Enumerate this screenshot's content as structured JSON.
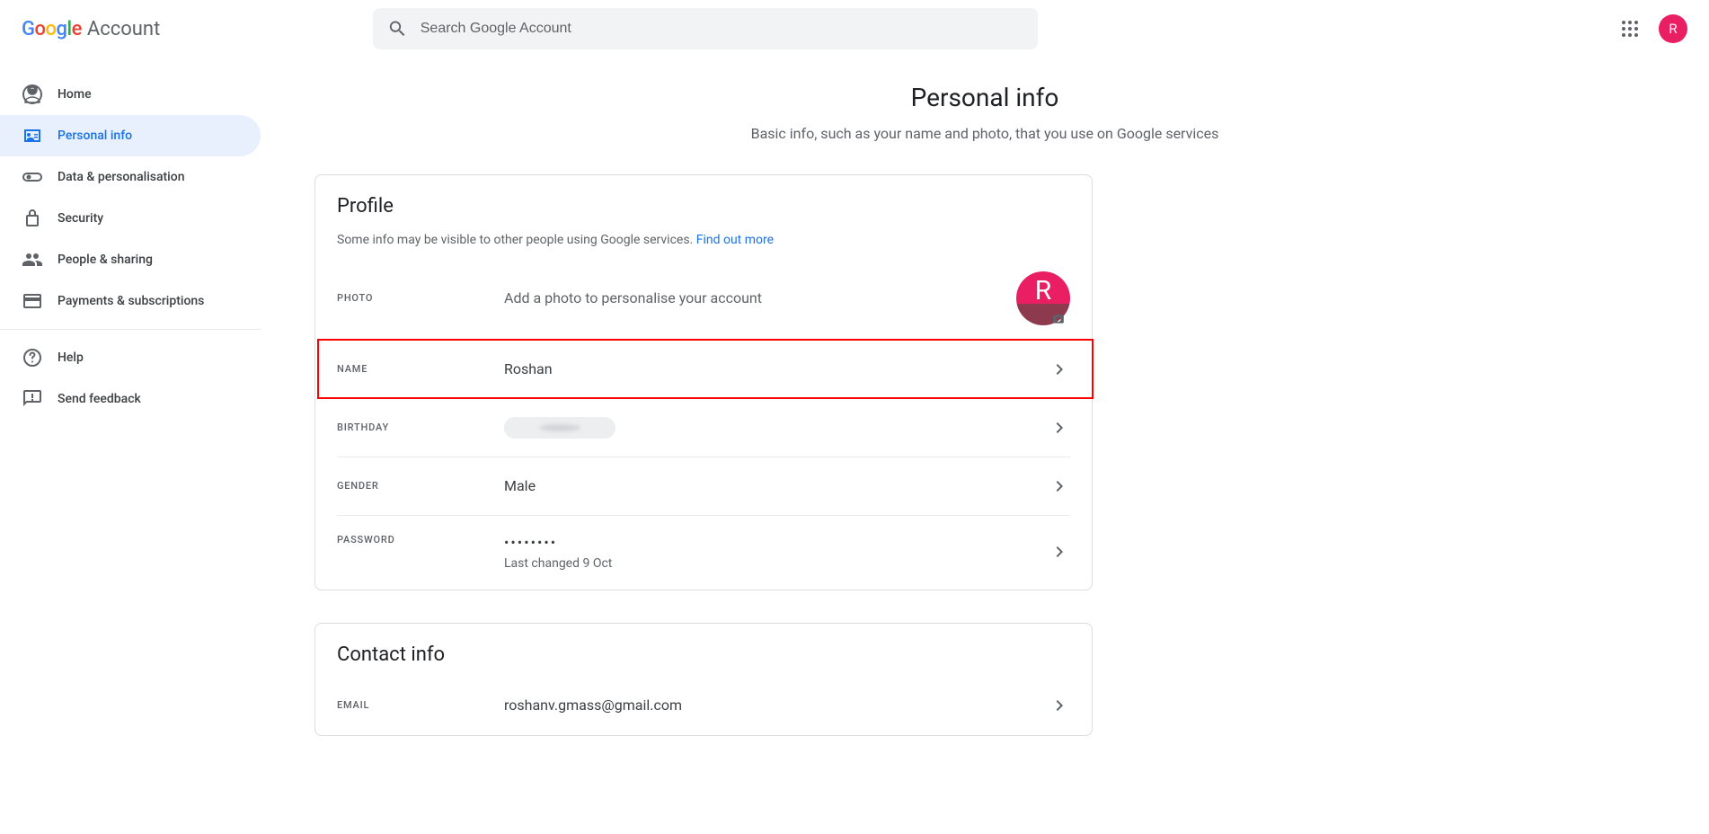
{
  "header": {
    "brand_prefix": "Google",
    "brand_suffix": "Account",
    "search_placeholder": "Search Google Account",
    "avatar_letter": "R"
  },
  "sidebar": {
    "items": [
      {
        "label": "Home"
      },
      {
        "label": "Personal info"
      },
      {
        "label": "Data & personalisation"
      },
      {
        "label": "Security"
      },
      {
        "label": "People & sharing"
      },
      {
        "label": "Payments & subscriptions"
      }
    ],
    "footer": [
      {
        "label": "Help"
      },
      {
        "label": "Send feedback"
      }
    ]
  },
  "page": {
    "title": "Personal info",
    "subtitle": "Basic info, such as your name and photo, that you use on Google services"
  },
  "profile": {
    "title": "Profile",
    "desc_text": "Some info may be visible to other people using Google services. ",
    "desc_link": "Find out more",
    "photo_label": "PHOTO",
    "photo_hint": "Add a photo to personalise your account",
    "photo_letter": "R",
    "name_label": "NAME",
    "name_value": "Roshan",
    "birthday_label": "BIRTHDAY",
    "gender_label": "GENDER",
    "gender_value": "Male",
    "password_label": "PASSWORD",
    "password_value": "••••••••",
    "password_sub": "Last changed 9 Oct"
  },
  "contact": {
    "title": "Contact info",
    "email_label": "EMAIL",
    "email_value": "roshanv.gmass@gmail.com"
  }
}
